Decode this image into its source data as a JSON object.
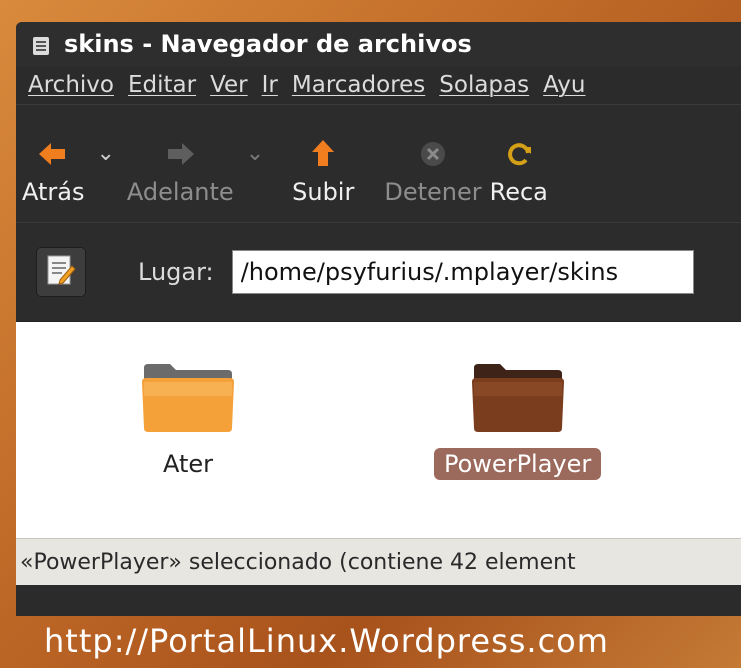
{
  "window": {
    "title": "skins - Navegador de archivos"
  },
  "menu": {
    "items": [
      "Archivo",
      "Editar",
      "Ver",
      "Ir",
      "Marcadores",
      "Solapas",
      "Ayu"
    ]
  },
  "toolbar": {
    "back_label": "Atrás",
    "forward_label": "Adelante",
    "up_label": "Subir",
    "stop_label": "Detener",
    "reload_label": "Reca"
  },
  "location": {
    "label": "Lugar:",
    "value": "/home/psyfurius/.mplayer/skins"
  },
  "files": [
    {
      "name": "Ater",
      "selected": false
    },
    {
      "name": "PowerPlayer",
      "selected": true
    }
  ],
  "status": {
    "text": "«PowerPlayer» seleccionado (contiene 42 element"
  },
  "watermark": {
    "text": "http://PortalLinux.Wordpress.com"
  },
  "colors": {
    "accent_orange": "#f07d1e",
    "selection": "#9c6a5d",
    "folder_brown": "#7a3d1e"
  }
}
